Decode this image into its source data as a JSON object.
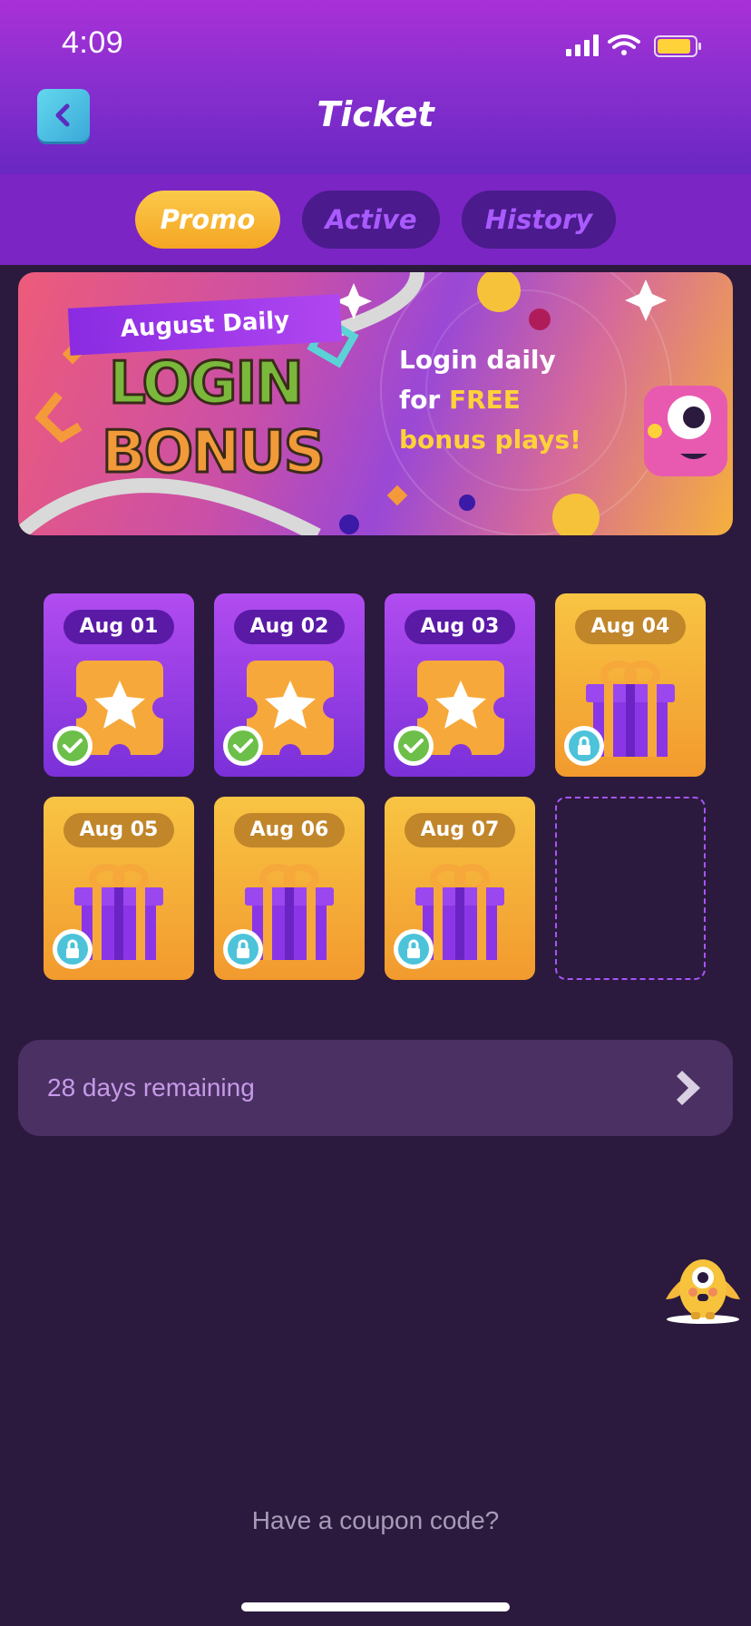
{
  "status_bar": {
    "time": "4:09"
  },
  "header": {
    "title": "Ticket"
  },
  "tabs": [
    {
      "label": "Promo",
      "selected": true
    },
    {
      "label": "Active",
      "selected": false
    },
    {
      "label": "History",
      "selected": false
    }
  ],
  "banner": {
    "tag": "August Daily",
    "headline_1": "LOGIN",
    "headline_2": "BONUS",
    "line_1": "Login daily",
    "line_2_prefix": "for ",
    "line_2_highlight": "FREE",
    "line_3": "bonus plays!"
  },
  "days": [
    {
      "label": "Aug 01",
      "state": "claimed"
    },
    {
      "label": "Aug 02",
      "state": "claimed"
    },
    {
      "label": "Aug 03",
      "state": "claimed"
    },
    {
      "label": "Aug 04",
      "state": "locked"
    },
    {
      "label": "Aug 05",
      "state": "locked"
    },
    {
      "label": "Aug 06",
      "state": "locked"
    },
    {
      "label": "Aug 07",
      "state": "locked"
    }
  ],
  "remaining": {
    "text": "28 days remaining"
  },
  "footer": {
    "coupon_link": "Have a coupon code?"
  },
  "colors": {
    "header_purple": "#8a2fd0",
    "promo_tab": "#f5a623",
    "background": "#2b1a3e",
    "claimed_card": "#9a3ee6",
    "locked_card": "#f5b03c"
  }
}
